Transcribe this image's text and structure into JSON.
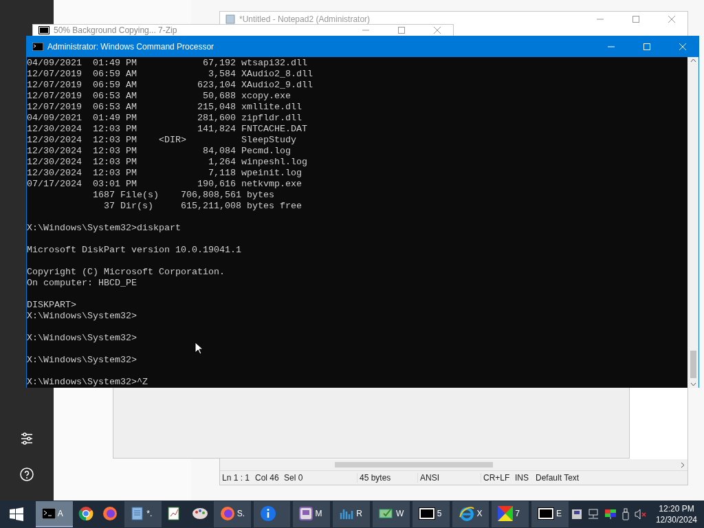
{
  "windows": {
    "notepad": {
      "title": "*Untitled - Notepad2 (Administrator)",
      "status_bar": [
        "Ln 1 : 1",
        "Col 46",
        "Sel 0",
        "45 bytes",
        "ANSI",
        "CR+LF",
        "INS",
        "Default Text"
      ]
    },
    "zip": {
      "title": "50% Background Copying... 7-Zip"
    },
    "console": {
      "title": "Administrator: Windows Command Processor",
      "blocks": [
        [
          "04/09/2021  01:49 PM            67,192 wtsapi32.dll",
          "12/07/2019  06:59 AM             3,584 XAudio2_8.dll",
          "12/07/2019  06:59 AM           623,104 XAudio2_9.dll",
          "12/07/2019  06:53 AM            50,688 xcopy.exe",
          "12/07/2019  06:53 AM           215,048 xmllite.dll",
          "04/09/2021  01:49 PM           281,600 zipfldr.dll",
          "12/30/2024  12:03 PM           141,824 FNTCACHE.DAT",
          "12/30/2024  12:03 PM    <DIR>          SleepStudy",
          "12/30/2024  12:03 PM            84,084 Pecmd.log",
          "12/30/2024  12:03 PM             1,264 winpeshl.log",
          "12/30/2024  12:03 PM             7,118 wpeinit.log",
          "07/17/2024  03:01 PM           190,616 netkvmp.exe",
          "            1687 File(s)    706,808,561 bytes",
          "              37 Dir(s)     615,211,008 bytes free"
        ],
        [
          "X:\\Windows\\System32>diskpart"
        ],
        [
          "Microsoft DiskPart version 10.0.19041.1"
        ],
        [
          "Copyright (C) Microsoft Corporation.",
          "On computer: HBCD_PE"
        ],
        [
          "DISKPART>",
          "X:\\Windows\\System32>"
        ],
        [
          "X:\\Windows\\System32>"
        ],
        [
          "X:\\Windows\\System32>"
        ],
        [
          "X:\\Windows\\System32>^Z"
        ]
      ]
    }
  },
  "taskbar": {
    "items": [
      {
        "kind": "window",
        "label": "A",
        "selected": true
      },
      {
        "kind": "pinned",
        "selected": false
      },
      {
        "kind": "pinned",
        "selected": false
      },
      {
        "kind": "window",
        "label": "*.",
        "selected": false
      },
      {
        "kind": "pinned",
        "selected": false
      },
      {
        "kind": "pinned",
        "selected": false
      },
      {
        "kind": "window",
        "label": "S.",
        "selected": false
      },
      {
        "kind": "window",
        "selected": false
      },
      {
        "kind": "window",
        "label": "M",
        "selected": false
      },
      {
        "kind": "window",
        "label": "R",
        "selected": false
      },
      {
        "kind": "window",
        "label": "W",
        "selected": false
      },
      {
        "kind": "window",
        "label": "5",
        "selected": false
      },
      {
        "kind": "window",
        "label": "X",
        "selected": false
      },
      {
        "kind": "window",
        "label": "7",
        "selected": false
      },
      {
        "kind": "window",
        "label": "E",
        "selected": false
      }
    ],
    "clock": {
      "time": "12:20 PM",
      "date": "12/30/2024"
    }
  }
}
